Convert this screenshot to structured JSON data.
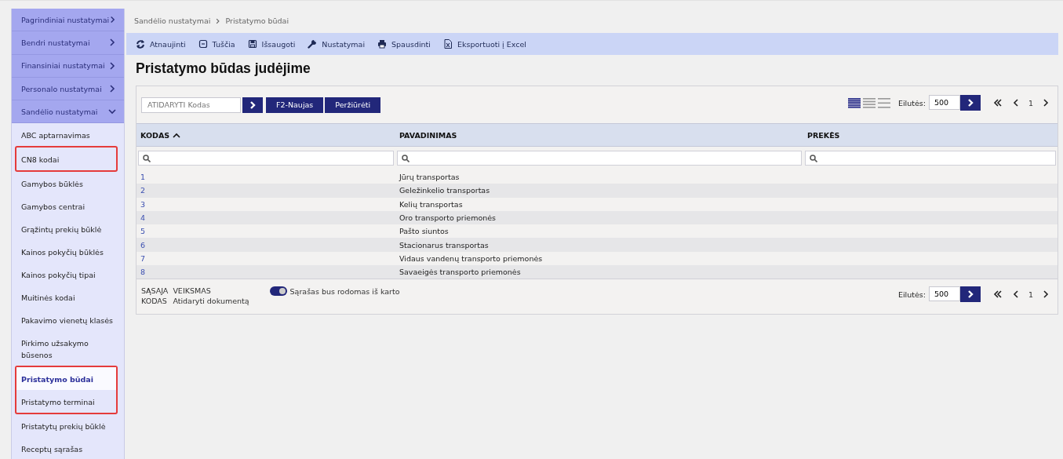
{
  "sidebar": {
    "groups": [
      {
        "label": "Pagrindiniai nustatymai",
        "expanded": false
      },
      {
        "label": "Bendri nustatymai",
        "expanded": false
      },
      {
        "label": "Finansiniai nustatymai",
        "expanded": false
      },
      {
        "label": "Personalo nustatymai",
        "expanded": false
      },
      {
        "label": "Sandėlio nustatymai",
        "expanded": true,
        "children": [
          {
            "label": "ABC aptarnavimas",
            "selected": false,
            "highlighted": false
          },
          {
            "label": "CN8 kodai",
            "selected": false,
            "highlighted": true
          },
          {
            "label": "Gamybos būklės",
            "selected": false,
            "highlighted": false
          },
          {
            "label": "Gamybos centrai",
            "selected": false,
            "highlighted": false
          },
          {
            "label": "Grąžintų prekių būklė",
            "selected": false,
            "highlighted": false
          },
          {
            "label": "Kainos pokyčių būklės",
            "selected": false,
            "highlighted": false
          },
          {
            "label": "Kainos pokyčių tipai",
            "selected": false,
            "highlighted": false
          },
          {
            "label": "Muitinės kodai",
            "selected": false,
            "highlighted": false
          },
          {
            "label": "Pakavimo vienetų klasės",
            "selected": false,
            "highlighted": false
          },
          {
            "label": "Pirkimo užsakymo būsenos",
            "selected": false,
            "highlighted": false
          },
          {
            "label": "Pristatymo būdai",
            "selected": true,
            "highlighted": true
          },
          {
            "label": "Pristatymo terminai",
            "selected": false,
            "highlighted": true
          },
          {
            "label": "Pristatytų prekių būklė",
            "selected": false,
            "highlighted": false
          },
          {
            "label": "Receptų sąrašas",
            "selected": false,
            "highlighted": false
          }
        ]
      }
    ]
  },
  "breadcrumb": [
    "Sandėlio nustatymai",
    "Pristatymo būdai"
  ],
  "toolbar": [
    "Atnaujinti",
    "Tuščia",
    "Išsaugoti",
    "Nustatymai",
    "Spausdinti",
    "Eksportuoti į Excel"
  ],
  "title": "Pristatymo būdas judėjime",
  "filter_bar": {
    "open_field": {
      "placeholder": "ATIDARYTI Kodas"
    },
    "buttons": [
      "F2-Naujas",
      "Peržiūrėti"
    ],
    "density_options": [
      {
        "selected": true
      },
      {
        "selected": false
      },
      {
        "selected": false
      }
    ],
    "rows_label": "Eilutės:",
    "rows_value": "500",
    "page": "1"
  },
  "table": {
    "columns": [
      {
        "label": "KODAS",
        "sorted": true
      },
      {
        "label": "PAVADINIMAS",
        "sorted": false
      },
      {
        "label": "PREKĖS",
        "sorted": false
      }
    ],
    "rows": [
      [
        "1",
        "Jūrų transportas"
      ],
      [
        "2",
        "Geležinkelio transportas"
      ],
      [
        "3",
        "Kelių transportas"
      ],
      [
        "4",
        "Oro transporto priemonės"
      ],
      [
        "5",
        "Pašto siuntos"
      ],
      [
        "6",
        "Stacionarus transportas"
      ],
      [
        "7",
        "Vidaus vandenų transporto priemonės"
      ],
      [
        "8",
        "Savaeigės transporto priemonės"
      ]
    ]
  },
  "footer": {
    "legend": [
      [
        "SĄSAJA",
        "VEIKSMAS"
      ],
      [
        "KODAS",
        "Atidaryti dokumentą"
      ]
    ],
    "toggle": {
      "label": "Sąrašas bus rodomas iš karto",
      "on": true
    },
    "rows_label": "Eilutės:",
    "rows_value": "500",
    "page": "1"
  }
}
